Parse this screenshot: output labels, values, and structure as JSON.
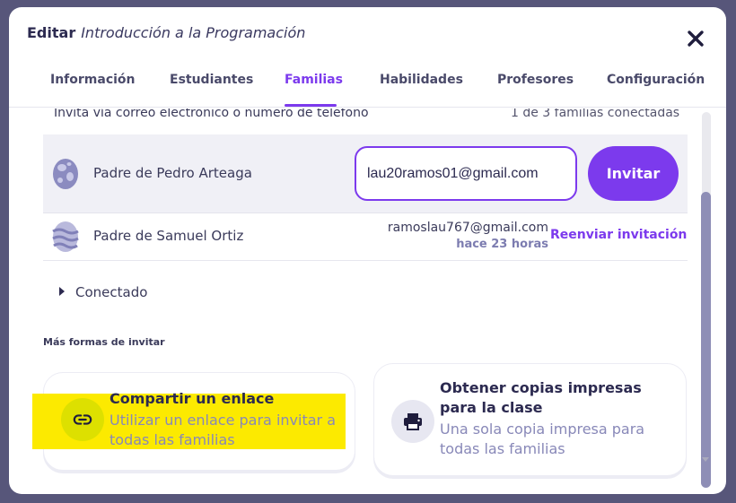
{
  "header": {
    "edit_label": "Editar",
    "course_name": "Introducción a la Programación"
  },
  "tabs": [
    {
      "label": "Información"
    },
    {
      "label": "Estudiantes"
    },
    {
      "label": "Familias"
    },
    {
      "label": "Habilidades"
    },
    {
      "label": "Profesores"
    },
    {
      "label": "Configuración"
    }
  ],
  "active_tab": "Familias",
  "invite_section": {
    "caption": "Invita vía correo electrónico o número de teléfono",
    "connected_count": "1 de 3 familias conectadas"
  },
  "families": [
    {
      "name": "Padre de Pedro Arteaga",
      "email_value": "lau20ramos01@gmail.com",
      "invite_label": "Invitar"
    },
    {
      "name": "Padre de Samuel Ortiz",
      "sent_email": "ramoslau767@gmail.com",
      "sent_time": "hace 23 horas",
      "resend_label": "Reenviar invitación"
    }
  ],
  "connected_label": "Conectado",
  "more_ways_label": "Más formas de invitar",
  "cards": [
    {
      "title": "Compartir un enlace",
      "description": "Utilizar un enlace para invitar a todas las familias",
      "icon": "link-icon"
    },
    {
      "title": "Obtener copias impresas para la clase",
      "description": "Una sola copia impresa para todas las familias",
      "icon": "printer-icon"
    }
  ],
  "colors": {
    "accent": "#7c3aed",
    "highlight": "#fcea00",
    "backdrop": "#57567a"
  }
}
